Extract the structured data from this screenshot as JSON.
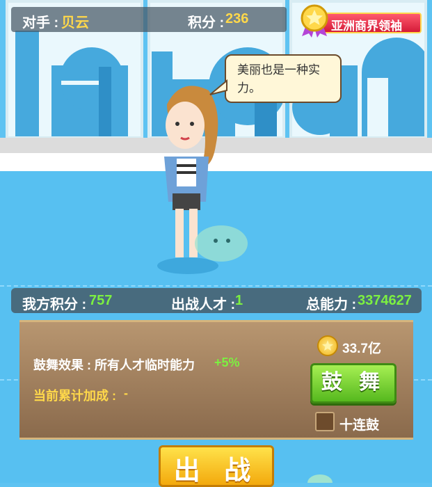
{
  "header": {
    "opponent_label": "对手 :",
    "opponent_name": "贝云",
    "score_label": "积分 :",
    "score_value": "236",
    "rank_title": "亚洲商界领袖"
  },
  "speech": {
    "text": "美丽也是一种实力。"
  },
  "stats": {
    "my_score_label": "我方积分 :",
    "my_score_value": "757",
    "talent_label": "出战人才 :",
    "talent_value": "1",
    "power_label": "总能力 :",
    "power_value": "3374627"
  },
  "cheer_panel": {
    "effect_label": "鼓舞效果 : 所有人才临时能力",
    "effect_value": "+5%",
    "bonus_label": "当前累计加成 :",
    "bonus_value": "-",
    "cost": "33.7亿",
    "cheer_button": "鼓 舞",
    "ten_cheer_label": "十连鼓"
  },
  "battle_button": "出 战",
  "colors": {
    "gold": "#ffd84a",
    "green": "#7cf041",
    "sky": "#5ec3f2",
    "cheer_green": "#56b81e",
    "battle_yellow": "#f3a90d"
  },
  "icons": [
    "star-medal-icon",
    "gold-coin-icon",
    "checkbox-icon"
  ]
}
